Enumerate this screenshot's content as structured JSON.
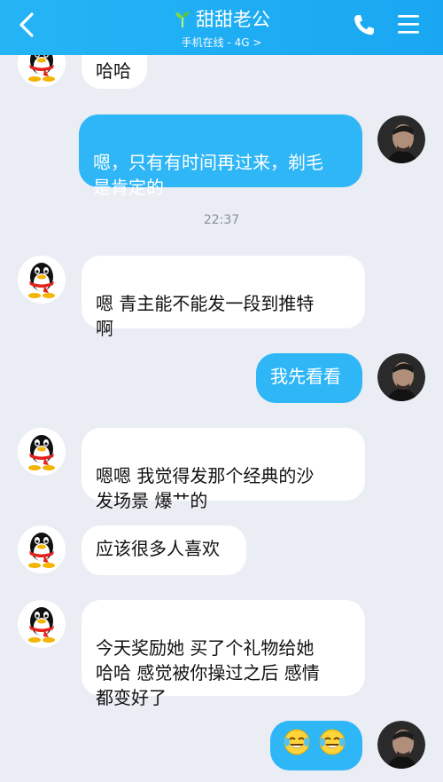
{
  "header": {
    "contact_name": "甜甜老公",
    "status": "手机在线 - 4G >"
  },
  "chat": {
    "timestamp": "22:37",
    "messages": [
      {
        "side": "in",
        "text": "哈哈"
      },
      {
        "side": "out",
        "text": "嗯，只有有时间再过来，剃毛\n是肯定的"
      },
      {
        "side": "in",
        "text": "嗯 青主能不能发一段到推特\n啊"
      },
      {
        "side": "out",
        "text": "我先看看"
      },
      {
        "side": "in",
        "text": "嗯嗯 我觉得发那个经典的沙\n发场景 爆艹的"
      },
      {
        "side": "in",
        "text": "应该很多人喜欢"
      },
      {
        "side": "in",
        "text": "今天奖励她 买了个礼物给她\n哈哈 感觉被你操过之后 感情\n都变好了"
      }
    ],
    "emoji_message": {
      "side": "out",
      "emojis": [
        "tears-of-joy",
        "tears-of-joy"
      ]
    }
  },
  "colors": {
    "header": "#19a7f2",
    "outgoing_bubble": "#2fb6f7",
    "incoming_bubble": "#ffffff",
    "background": "#eaedf4"
  }
}
